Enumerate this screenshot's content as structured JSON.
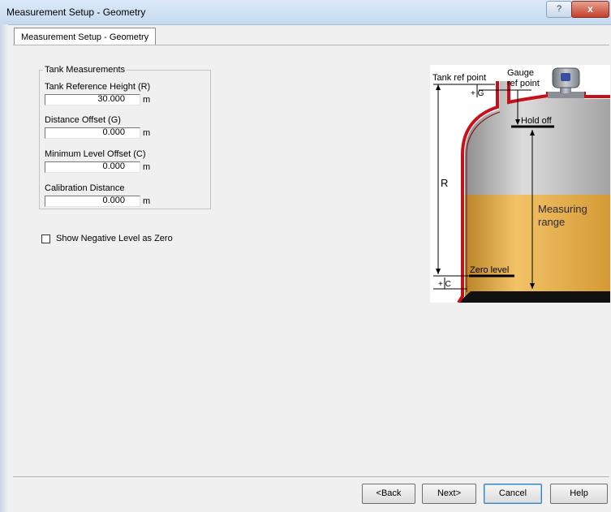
{
  "window": {
    "title": "Measurement Setup - Geometry",
    "help_glyph": "?",
    "close_glyph": "x"
  },
  "tab": {
    "label": "Measurement Setup - Geometry"
  },
  "group": {
    "label": "Tank Measurements",
    "fields": [
      {
        "label": "Tank Reference Height (R)",
        "value": "30.000",
        "unit": "m"
      },
      {
        "label": "Distance Offset (G)",
        "value": "0.000",
        "unit": "m"
      },
      {
        "label": "Minimum Level Offset (C)",
        "value": "0.000",
        "unit": "m"
      },
      {
        "label": "Calibration Distance",
        "value": "0.000",
        "unit": "m"
      }
    ]
  },
  "checkbox": {
    "label": "Show Negative Level as Zero",
    "checked": false
  },
  "diagram": {
    "tank_ref_point": "Tank ref point",
    "gauge_ref_point_line1": "Gauge",
    "gauge_ref_point_line2": "ref point",
    "g_label": "+ G",
    "hold_off": "Hold off",
    "r_label": "R",
    "measuring_line1": "Measuring",
    "measuring_line2": "range",
    "zero_level": "Zero level",
    "c_label": "+ C",
    "colors": {
      "tank_outline": "#c8101a",
      "liquid": "#e3aa3e",
      "gas": "#c2c2c2"
    }
  },
  "buttons": {
    "back": "<Back",
    "next": "Next>",
    "cancel": "Cancel",
    "help": "Help"
  }
}
